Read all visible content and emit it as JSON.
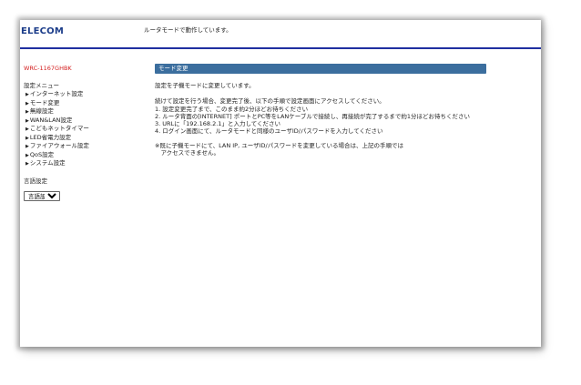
{
  "header": {
    "logo": "ELECOM",
    "status": "ルータモードで動作しています。"
  },
  "sidebar": {
    "model": "WRC-1167GHBK",
    "menu_heading": "設定メニュー",
    "items": [
      {
        "label": "インターネット設定"
      },
      {
        "label": "モード変更"
      },
      {
        "label": "無線設定"
      },
      {
        "label": "WAN&LAN設定"
      },
      {
        "label": "こどもネットタイマー"
      },
      {
        "label": "LED省電力設定"
      },
      {
        "label": "ファイアウォール設定"
      },
      {
        "label": "QoS設定"
      },
      {
        "label": "システム設定"
      }
    ],
    "language_heading": "言語設定",
    "language_select": "言語設定"
  },
  "main": {
    "section_title": "モード変更",
    "intro": "設定を子機モードに変更しています。",
    "lines": [
      "続けて設定を行う場合、変更完了後、以下の手順で設定画面にアクセスしてください。",
      "1. 設定変更完了まで、このまま約2分ほどお待ちください",
      "2. ルータ背面の[INTERNET] ポートとPC等をLANケーブルで接続し、再接続が完了するまで約1分ほどお待ちください",
      "3. URLに「192.168.2.1」と入力してください",
      "4. ログイン画面にて、ルータモードと同様のユーザID/パスワードを入力してください"
    ],
    "note_lines": [
      "※既に子機モードにて、LAN IP, ユーザID/パスワードを変更している場合は、上記の手順では",
      "　アクセスできません。"
    ]
  }
}
